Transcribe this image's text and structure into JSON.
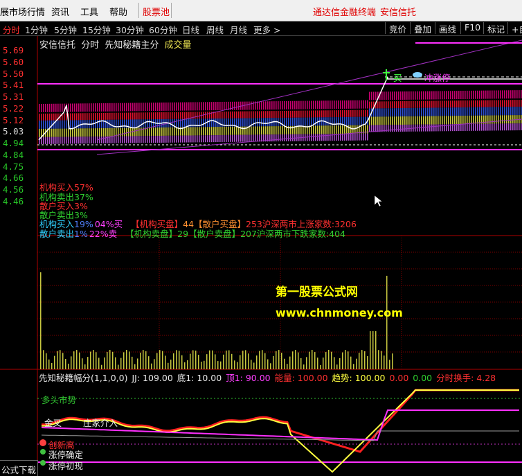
{
  "menu": {
    "items": [
      "展市场行情",
      "资讯",
      "工具",
      "帮助"
    ],
    "stock_pool": "股票池",
    "right_title": "通达信金融终端",
    "right_stock": "安信信托"
  },
  "periods": [
    "分时",
    "1分钟",
    "5分钟",
    "15分钟",
    "30分钟",
    "60分钟",
    "日线",
    "周线",
    "月线",
    "更多 >"
  ],
  "active_period": "分时",
  "tools": [
    "竞价",
    "叠加",
    "画线",
    "F10",
    "标记",
    "+自"
  ],
  "chart_header": {
    "stock": "安信信托",
    "mode": "分时",
    "indicator": "先知秘籍主分",
    "volume_label": "成交量"
  },
  "price_axis": [
    "5.69",
    "5.60",
    "5.50",
    "5.41",
    "5.31",
    "5.22",
    "5.12",
    "5.03",
    "4.94",
    "4.84",
    "4.75",
    "4.66",
    "4.56",
    "4.46"
  ],
  "price_axis_colors": [
    "#ff3030",
    "#ff3030",
    "#ff3030",
    "#ff3030",
    "#ff3030",
    "#ff3030",
    "#ff3030",
    "#d8d8d8",
    "#28c828",
    "#28c828",
    "#28c828",
    "#28c828",
    "#28c828",
    "#28c828"
  ],
  "signals": {
    "buy_label": "买",
    "limit_label": "冲涨停"
  },
  "flow": {
    "inst_buy": "机构买入57%",
    "inst_sell": "机构卖出37%",
    "retail_buy": "散户买入3%",
    "retail_sell": "散户卖出3%"
  },
  "flow_row1": {
    "a": "机构买入",
    "b": "19%",
    "c": "04%买",
    "d": "【机构买盘】",
    "e": "44【散户买盘】",
    "f": "253沪深两市上涨家数:3206"
  },
  "flow_row2": {
    "a": "散户卖出",
    "b": "1%",
    "c": "22%卖",
    "d": "【机构卖盘】",
    "e": "29【散户卖盘】",
    "f": "207沪深两市下跌家数:404"
  },
  "watermark": {
    "line1": "第一股票公式网",
    "line2": "www.chnmoney.com"
  },
  "sub_header": {
    "name": "先知秘籍幅分(1,1,0,0)",
    "jj": "JJ: 109.00",
    "di": "底1: 10.00",
    "ding": "顶1: 90.00",
    "energy": "能量: 100.00",
    "trend": "趋势: 100.00",
    "z1": "0.00",
    "z2": "0.00",
    "turnover": "分时换手: 4.28"
  },
  "sub_labels": {
    "bull": "多头市势",
    "golden": "金叉",
    "zhuang": "庄家介入",
    "chuang": "创新高",
    "confirm": "涨停确定",
    "first": "涨停初现"
  },
  "bottom": {
    "formula_download": "公式下载"
  }
}
